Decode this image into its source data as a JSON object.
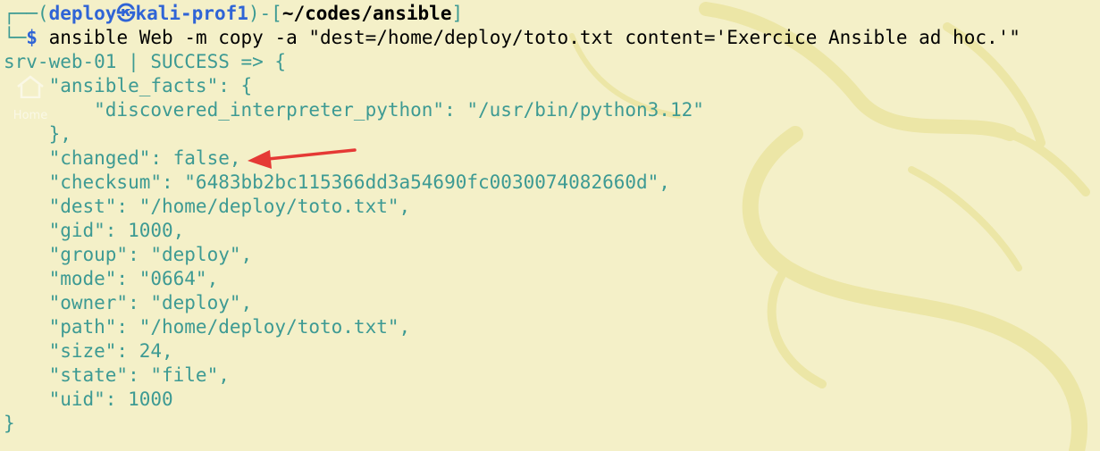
{
  "desktop": {
    "home_icon_label": "Home"
  },
  "prompt": {
    "user": "deploy",
    "at_symbol": "㉿",
    "host": "kali-prof1",
    "path": "~/codes/ansible",
    "symbol": "$",
    "command": "ansible Web -m copy -a \"dest=/home/deploy/toto.txt content='Exercice Ansible ad hoc.'\""
  },
  "output": {
    "header": "srv-web-01 | SUCCESS => {",
    "lines": [
      "    \"ansible_facts\": {",
      "        \"discovered_interpreter_python\": \"/usr/bin/python3.12\"",
      "    },",
      "    \"changed\": false,",
      "    \"checksum\": \"6483bb2bc115366dd3a54690fc0030074082660d\",",
      "    \"dest\": \"/home/deploy/toto.txt\",",
      "    \"gid\": 1000,",
      "    \"group\": \"deploy\",",
      "    \"mode\": \"0664\",",
      "    \"owner\": \"deploy\",",
      "    \"path\": \"/home/deploy/toto.txt\",",
      "    \"size\": 24,",
      "    \"state\": \"file\",",
      "    \"uid\": 1000"
    ],
    "footer": "}"
  },
  "colors": {
    "background": "#f4f0c8",
    "output_text": "#3d9a93",
    "prompt_blue": "#2f64d6",
    "annotation_arrow": "#e53935"
  },
  "icons": [
    "home-icon",
    "kali-dragon-watermark",
    "annotation-arrow-icon"
  ]
}
